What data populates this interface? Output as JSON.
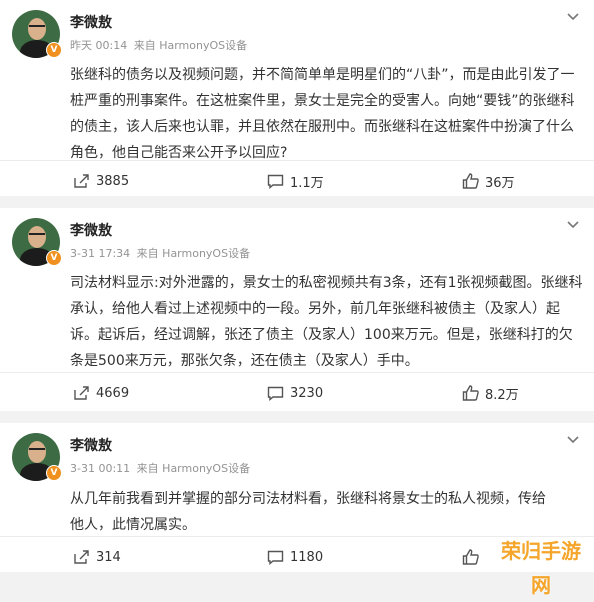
{
  "posts": [
    {
      "author": "李微敖",
      "time": "昨天 00:14",
      "source": "来自 HarmonyOS设备",
      "content": "张继科的债务以及视频问题，并不简简单单是明星们的“八卦”，而是由此引发了一桩严重的刑事案件。在这桩案件里，景女士是完全的受害人。向她“要钱”的张继科的债主，该人后来也认罪，并且依然在服刑中。而张继科在这桩案件中扮演了什么角色，他自己能否来公开予以回应?",
      "reposts": "3885",
      "comments": "1.1万",
      "likes": "36万"
    },
    {
      "author": "李微敖",
      "time": "3-31 17:34",
      "source": "来自 HarmonyOS设备",
      "content": "司法材料显示:对外泄露的，景女士的私密视频共有3条，还有1张视频截图。张继科承认，给他人看过上述视频中的一段。另外，前几年张继科被债主（及家人）起诉。起诉后，经过调解，张还了债主（及家人）100来万元。但是，张继科打的欠条是500来万元，那张欠条，还在债主（及家人）手中。",
      "reposts": "4669",
      "comments": "3230",
      "likes": "8.2万"
    },
    {
      "author": "李微敖",
      "time": "3-31 00:11",
      "source": "来自 HarmonyOS设备",
      "content": "从几年前我看到并掌握的部分司法材料看，张继科将景女士的私人视频，传给他人，此情况属实。",
      "reposts": "314",
      "comments": "1180",
      "likes": ""
    }
  ],
  "verified_badge": "V",
  "watermark": "荣归手游网",
  "icons": [
    "chevron-down-icon",
    "repost-icon",
    "comment-icon",
    "like-icon"
  ],
  "colors": {
    "badge": "#f0901e",
    "meta": "#939393",
    "watermark": "#f4a52a"
  }
}
